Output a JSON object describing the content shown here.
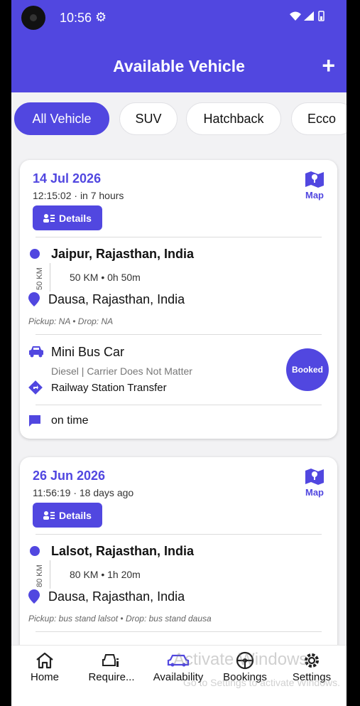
{
  "status": {
    "time": "10:56"
  },
  "header": {
    "title": "Available Vehicle",
    "add_label": "+"
  },
  "filters": [
    "All Vehicle",
    "SUV",
    "Hatchback",
    "Ecco"
  ],
  "bookings": [
    {
      "date": "14 Jul 2026",
      "time_line": "12:15:02 · in 7 hours",
      "map_label": "Map",
      "details_label": "Details",
      "from": "Jaipur, Rajasthan, India",
      "distance_vertical": "50 KM",
      "distance_line": "50 KM • 0h 50m",
      "to": "Dausa, Rajasthan, India",
      "pickup_drop": "Pickup: NA  •  Drop: NA",
      "vehicle_name": "Mini Bus Car",
      "vehicle_desc": "Diesel | Carrier Does Not Matter",
      "trip_type": "Railway Station Transfer",
      "status_badge": "Booked",
      "note": "on time"
    },
    {
      "date": "26 Jun 2026",
      "time_line": "11:56:19 · 18 days ago",
      "map_label": "Map",
      "details_label": "Details",
      "from": "Lalsot, Rajasthan, India",
      "distance_vertical": "80 KM",
      "distance_line": "80 KM • 1h 20m",
      "to": "Dausa, Rajasthan, India",
      "pickup_drop": "Pickup: bus stand lalsot  •  Drop: bus stand dausa"
    }
  ],
  "nav": [
    {
      "label": "Home",
      "icon": "home-icon"
    },
    {
      "label": "Require...",
      "icon": "car-info-icon"
    },
    {
      "label": "Availability",
      "icon": "car-icon"
    },
    {
      "label": "Bookings",
      "icon": "steering-icon"
    },
    {
      "label": "Settings",
      "icon": "gear-icon"
    }
  ],
  "watermark": {
    "title": "Activate Windows",
    "subtitle": "Go to Settings to activate Windows."
  },
  "colors": {
    "primary": "#5147e0",
    "background": "#f2f2f4"
  }
}
